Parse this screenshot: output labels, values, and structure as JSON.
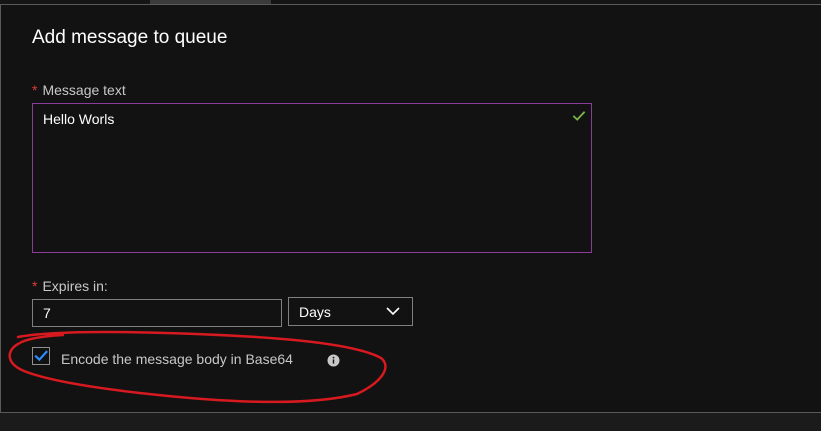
{
  "panel": {
    "title": "Add message to queue"
  },
  "form": {
    "required_marker": "*",
    "message": {
      "label": "Message text",
      "value": "Hello Worls",
      "status_icon": "check-icon"
    },
    "expires": {
      "label": "Expires in:",
      "value": "7",
      "unit": {
        "selected": "Days",
        "icon": "chevron-down-icon"
      }
    },
    "encode": {
      "checked": true,
      "label": "Encode the message body in Base64",
      "info_icon": "info-icon"
    }
  },
  "colors": {
    "background": "#121212",
    "text": "#ffffff",
    "muted_text": "#c8c8c8",
    "required": "#e23b3b",
    "focused_border": "#8a3c98",
    "success": "#7ab648",
    "checkbox_blue": "#2f8cff",
    "annotation": "#d71920"
  }
}
